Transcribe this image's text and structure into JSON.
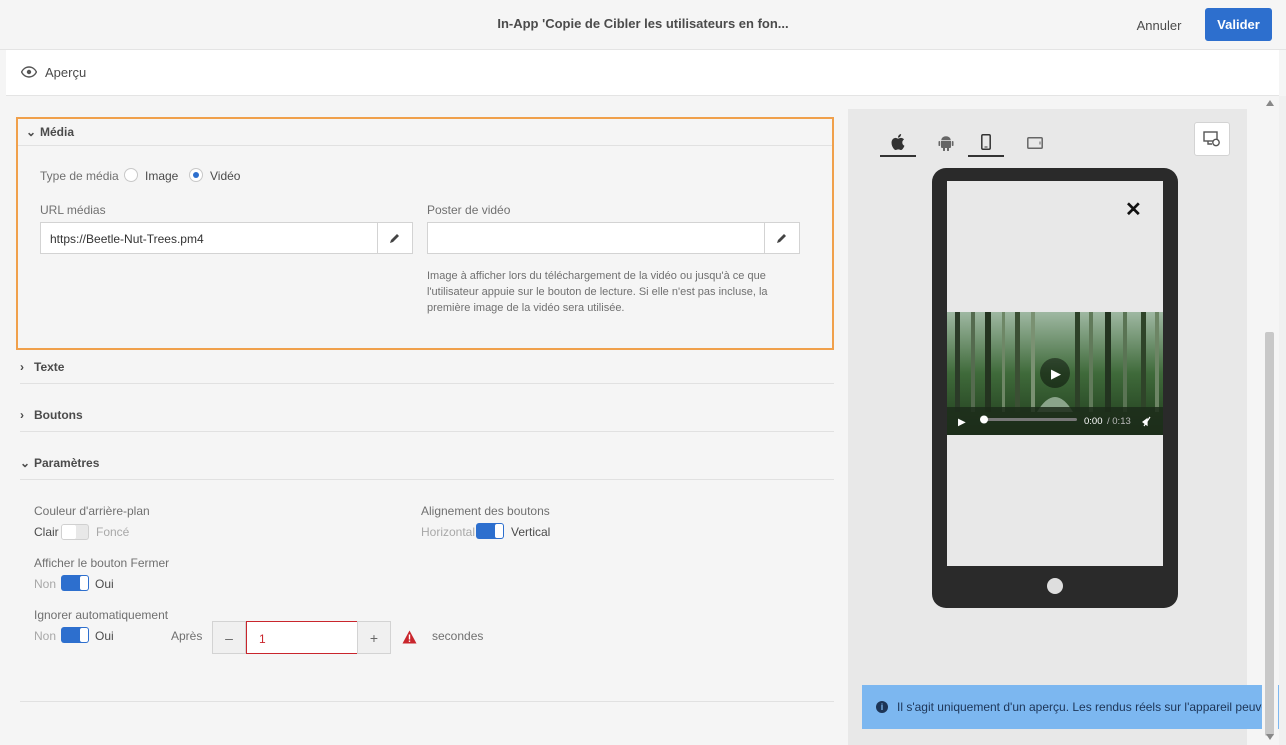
{
  "header": {
    "title": "In-App 'Copie de Cibler les utilisateurs en fon...",
    "cancel_label": "Annuler",
    "validate_label": "Valider"
  },
  "preview_bar": {
    "label": "Aperçu"
  },
  "sections": {
    "media": {
      "title": "Média",
      "media_type_label": "Type de média",
      "option_image": "Image",
      "option_video": "Vidéo",
      "selected": "Vidéo",
      "url_label": "URL médias",
      "url_value": "https://Beetle-Nut-Trees.pm4",
      "poster_label": "Poster de vidéo",
      "poster_value": "",
      "poster_help": "Image à afficher lors du téléchargement de la vidéo ou jusqu'à ce que l'utilisateur appuie sur le bouton de lecture. Si elle n'est pas incluse, la première image de la vidéo sera utilisée."
    },
    "text": {
      "title": "Texte"
    },
    "buttons": {
      "title": "Boutons"
    },
    "params": {
      "title": "Paramètres",
      "bg_color_label": "Couleur d'arrière-plan",
      "bg_off": "Clair",
      "bg_on": "Foncé",
      "bg_enabled": false,
      "btn_align_label": "Alignement des boutons",
      "align_off": "Horizontal",
      "align_on": "Vertical",
      "align_enabled": true,
      "close_label": "Afficher le bouton Fermer",
      "close_off": "Non",
      "close_on": "Oui",
      "close_enabled": true,
      "auto_label": "Ignorer automatiquement",
      "auto_off": "Non",
      "auto_on": "Oui",
      "auto_enabled": true,
      "after_label": "Après",
      "minus": "–",
      "plus": "+",
      "seconds_value": "1",
      "seconds_label": "secondes"
    }
  },
  "preview": {
    "video_time": "0:00",
    "video_duration": "/ 0:13",
    "close_glyph": "✕",
    "play_glyph": "▶",
    "notice": "Il s'agit uniquement d'un aperçu. Les rendus réels sur l'appareil peuvent"
  },
  "colors": {
    "accent": "#2d6fce",
    "highlight": "#f0a04b",
    "error": "#c9252c",
    "notice_bg": "#7cb7f0"
  }
}
